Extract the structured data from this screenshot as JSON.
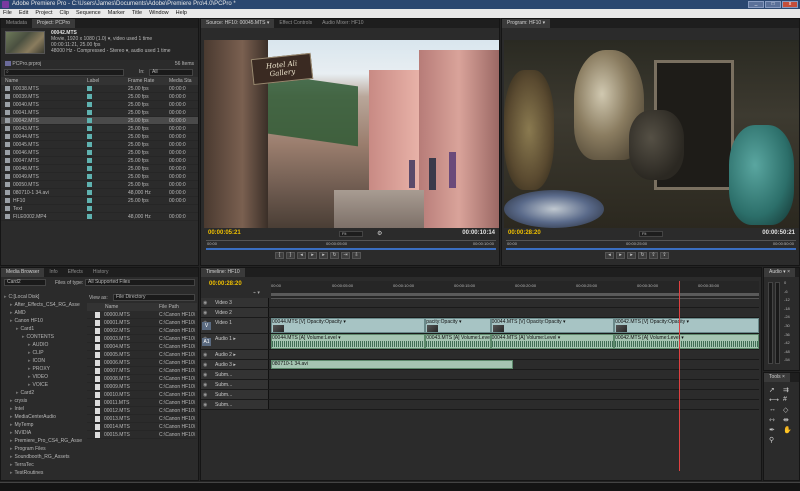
{
  "titlebar": {
    "title": "Adobe Premiere Pro - C:\\Users\\James\\Documents\\Adobe\\Premiere Pro\\4.0\\PCPro *",
    "min": "_",
    "max": "□",
    "close": "x"
  },
  "menu": [
    "File",
    "Edit",
    "Project",
    "Clip",
    "Sequence",
    "Marker",
    "Title",
    "Window",
    "Help"
  ],
  "project": {
    "tabs": [
      "Metadata",
      "Project: PCPro"
    ],
    "clip_name": "00042.MTS",
    "clip_info1": "Movie, 1920 x 1080 (1.0) ▾, video used 1 time",
    "clip_info2": "00:00:11:21, 25.00 fps",
    "clip_info3": "48000 Hz - Compressed - Stereo ▾, audio used 1 time",
    "file_name": "PCPro.prproj",
    "item_count": "56 Items",
    "in_label": "In:",
    "in_value": "All",
    "columns": [
      "Name",
      "Label",
      "Frame Rate",
      "Media Sta"
    ],
    "rows": [
      {
        "name": "00038.MTS",
        "fps": "25.00 fps",
        "start": "00:00:0"
      },
      {
        "name": "00039.MTS",
        "fps": "25.00 fps",
        "start": "00:00:0"
      },
      {
        "name": "00040.MTS",
        "fps": "25.00 fps",
        "start": "00:00:0"
      },
      {
        "name": "00041.MTS",
        "fps": "25.00 fps",
        "start": "00:00:0"
      },
      {
        "name": "00042.MTS",
        "fps": "25.00 fps",
        "start": "00:00:0"
      },
      {
        "name": "00043.MTS",
        "fps": "25.00 fps",
        "start": "00:00:0"
      },
      {
        "name": "00044.MTS",
        "fps": "25.00 fps",
        "start": "00:00:0"
      },
      {
        "name": "00045.MTS",
        "fps": "25.00 fps",
        "start": "00:00:0"
      },
      {
        "name": "00046.MTS",
        "fps": "25.00 fps",
        "start": "00:00:0"
      },
      {
        "name": "00047.MTS",
        "fps": "25.00 fps",
        "start": "00:00:0"
      },
      {
        "name": "00048.MTS",
        "fps": "25.00 fps",
        "start": "00:00:0"
      },
      {
        "name": "00049.MTS",
        "fps": "25.00 fps",
        "start": "00:00:0"
      },
      {
        "name": "00050.MTS",
        "fps": "25.00 fps",
        "start": "00:00:0"
      },
      {
        "name": "080710-1 34.avi",
        "fps": "48,000 Hz",
        "start": "00:00:0"
      },
      {
        "name": "HF10",
        "fps": "25.00 fps",
        "start": "00:00:0"
      },
      {
        "name": "Text",
        "fps": "",
        "start": ""
      },
      {
        "name": "FILE0002.MP4",
        "fps": "48,000 Hz",
        "start": "00:00:0"
      }
    ]
  },
  "media_browser": {
    "tabs": [
      "Media Browser",
      "Info",
      "Effects",
      "History"
    ],
    "drive": "Card2",
    "files_of_type_label": "Files of type:",
    "files_of_type": "All Supported Files",
    "view_as_label": "View as:",
    "view_as": "File Directory",
    "tree": [
      {
        "label": "C:[Local Disk]",
        "depth": 0
      },
      {
        "label": "After_Effects_CS4_RG_Asse",
        "depth": 1
      },
      {
        "label": "AMD",
        "depth": 1
      },
      {
        "label": "Canon HF10",
        "depth": 1
      },
      {
        "label": "Card1",
        "depth": 2
      },
      {
        "label": "CONTENTS",
        "depth": 3
      },
      {
        "label": "AUDIO",
        "depth": 4
      },
      {
        "label": "CLIP",
        "depth": 4
      },
      {
        "label": "ICON",
        "depth": 4
      },
      {
        "label": "PROXY",
        "depth": 4
      },
      {
        "label": "VIDEO",
        "depth": 4
      },
      {
        "label": "VOICE",
        "depth": 4
      },
      {
        "label": "Card2",
        "depth": 2
      },
      {
        "label": "crysis",
        "depth": 1
      },
      {
        "label": "Intel",
        "depth": 1
      },
      {
        "label": "MediaCenterAudio",
        "depth": 1
      },
      {
        "label": "MyTemp",
        "depth": 1
      },
      {
        "label": "NVIDIA",
        "depth": 1
      },
      {
        "label": "Premiere_Pro_CS4_RG_Asse",
        "depth": 1
      },
      {
        "label": "Program Files",
        "depth": 1
      },
      {
        "label": "Soundbooth_RG_Assets",
        "depth": 1
      },
      {
        "label": "TerraTec",
        "depth": 1
      },
      {
        "label": "TestRoutines",
        "depth": 1
      }
    ],
    "columns": [
      "Name",
      "File Path"
    ],
    "files": [
      {
        "name": "00000.MTS",
        "path": "C:\\Canon HF10\\"
      },
      {
        "name": "00001.MTS",
        "path": "C:\\Canon HF10\\"
      },
      {
        "name": "00002.MTS",
        "path": "C:\\Canon HF10\\"
      },
      {
        "name": "00003.MTS",
        "path": "C:\\Canon HF10\\"
      },
      {
        "name": "00004.MTS",
        "path": "C:\\Canon HF10\\"
      },
      {
        "name": "00005.MTS",
        "path": "C:\\Canon HF10\\"
      },
      {
        "name": "00006.MTS",
        "path": "C:\\Canon HF10\\"
      },
      {
        "name": "00007.MTS",
        "path": "C:\\Canon HF10\\"
      },
      {
        "name": "00008.MTS",
        "path": "C:\\Canon HF10\\"
      },
      {
        "name": "00009.MTS",
        "path": "C:\\Canon HF10\\"
      },
      {
        "name": "00010.MTS",
        "path": "C:\\Canon HF10\\"
      },
      {
        "name": "00011.MTS",
        "path": "C:\\Canon HF10\\"
      },
      {
        "name": "00012.MTS",
        "path": "C:\\Canon HF10\\"
      },
      {
        "name": "00013.MTS",
        "path": "C:\\Canon HF10\\"
      },
      {
        "name": "00014.MTS",
        "path": "C:\\Canon HF10\\"
      },
      {
        "name": "00015.MTS",
        "path": "C:\\Canon HF10\\"
      }
    ]
  },
  "source": {
    "tabs": [
      "Source: HF10: 00045.MTS ▾",
      "Effect Controls",
      "Audio Mixer: HF10"
    ],
    "timecode": "00:00:05:21",
    "fit": "Fit",
    "duration": "00:00:10:14",
    "ruler_start": "00:00",
    "ruler_mid": "00:00:05:00",
    "ruler_end": "00:00:10:00",
    "shop_sign": "Hotel Ali Gallery"
  },
  "program": {
    "tabs": [
      "Program: HF10 ▾"
    ],
    "timecode": "00:00:28:20",
    "fit": "Fit",
    "duration": "00:00:50:21",
    "ruler_start": "00:00",
    "ruler_mid": "00:00:25:00",
    "ruler_end": "00:00:50:00"
  },
  "timeline": {
    "tab": "Timeline: HF10",
    "timecode": "00:00:28:20",
    "ruler": [
      "00:00",
      "00:00:05:00",
      "00:00:10:00",
      "00:00:15:00",
      "00:00:20:00",
      "00:00:25:00",
      "00:00:30:00",
      "00:00:35:00"
    ],
    "playhead_fraction": 0.837,
    "tracks": [
      {
        "label": "Video 3"
      },
      {
        "label": "Video 2"
      },
      {
        "label": "Video 1"
      },
      {
        "label": "Audio 1 ▸"
      },
      {
        "label": "Audio 2 ▸"
      },
      {
        "label": "Audio 3 ▸"
      },
      {
        "label": "Subm..."
      },
      {
        "label": "Subm..."
      },
      {
        "label": "Subm..."
      },
      {
        "label": "Subm..."
      }
    ],
    "v1_track_label": "V",
    "a1_track_label": "A1",
    "video_clips": [
      {
        "label": "00044.MTS [V]  Opacity:Opacity ▾",
        "start": 0.0,
        "end": 0.316
      },
      {
        "label": "pacity:Opacity ▾",
        "start": 0.316,
        "end": 0.45
      },
      {
        "label": "00044.MTS [V]  Opacity:Opacity ▾",
        "start": 0.45,
        "end": 0.703
      },
      {
        "label": "00042.MTS [V]  Opacity:Opacity ▾",
        "start": 0.703,
        "end": 1.0
      }
    ],
    "audio_clips": [
      {
        "label": "00044.MTS [A]  Volume:Level ▾",
        "start": 0.0,
        "end": 0.316
      },
      {
        "label": "00043.MTS [A]  Volume:Level ▾",
        "start": 0.316,
        "end": 0.45
      },
      {
        "label": "00044.MTS [A]  Volume:Level ▾",
        "start": 0.45,
        "end": 0.703
      },
      {
        "label": "00042.MTS [A]  Volume:Level ▾",
        "start": 0.703,
        "end": 1.0
      }
    ],
    "audio3_clip": {
      "label": "080710-1 34.avi",
      "start": 0.0,
      "end": 0.495
    }
  },
  "audio_meters": {
    "tab": "Audio ▾ ×",
    "scale": [
      "0",
      "-6",
      "-12",
      "-18",
      "-24",
      "-30",
      "-36",
      "-42",
      "-48",
      "-54"
    ]
  },
  "tools": {
    "tab": "Tools ×"
  }
}
